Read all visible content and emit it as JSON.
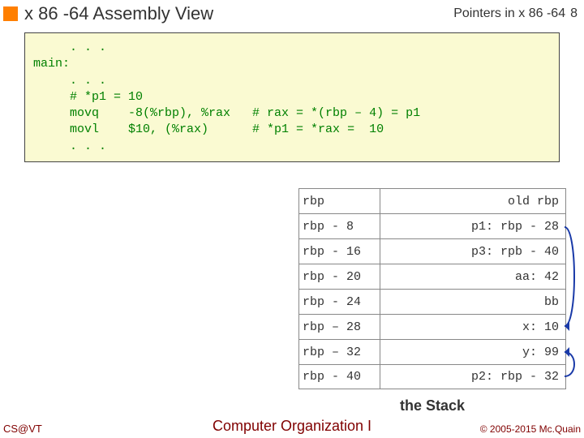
{
  "header": {
    "title": "x 86 -64 Assembly View",
    "topic": "Pointers in x 86 -64",
    "page": "8"
  },
  "code": "     . . .\nmain:\n     . . .\n     # *p1 = 10\n     movq    -8(%rbp), %rax   # rax = *(rbp – 4) = p1\n     movl    $10, (%rax)      # *p1 = *rax =  10\n     . . .",
  "stack": {
    "label": "the Stack",
    "rows": [
      {
        "offset": "rbp",
        "value": "old rbp"
      },
      {
        "offset": "rbp -  8",
        "value": "p1: rbp - 28"
      },
      {
        "offset": "rbp - 16",
        "value": "p3: rpb - 40"
      },
      {
        "offset": "rbp - 20",
        "value": "aa:   42"
      },
      {
        "offset": "rbp - 24",
        "value": "bb"
      },
      {
        "offset": "rbp – 28",
        "value": "x:   10"
      },
      {
        "offset": "rbp – 32",
        "value": "y:   99"
      },
      {
        "offset": "rbp - 40",
        "value": "p2: rbp - 32"
      }
    ]
  },
  "footer": {
    "left": "CS@VT",
    "center": "Computer Organization I",
    "right": "© 2005-2015 Mc.Quain"
  }
}
